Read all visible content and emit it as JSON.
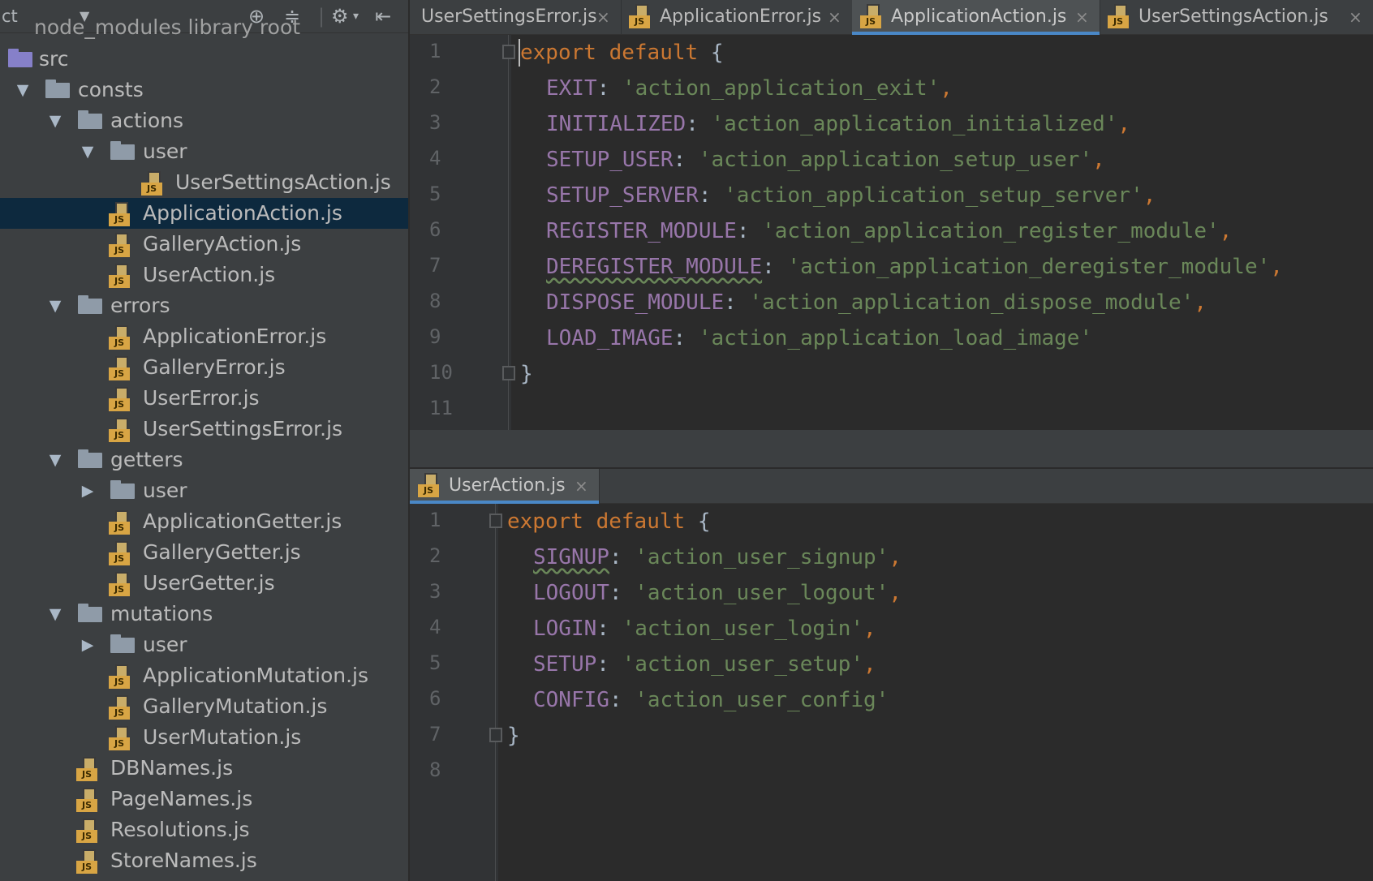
{
  "sidebar": {
    "toolbar": {
      "view_selector": "ct",
      "dropdown_icon": "chevron-down-icon",
      "icons": [
        "locate-icon",
        "collapse-all-icon",
        "gear-icon",
        "hide-panel-icon"
      ]
    },
    "partial_item": "node_modules  library root",
    "tree": [
      {
        "label": "src",
        "type": "src-folder"
      },
      {
        "label": "consts",
        "type": "folder",
        "expanded": true
      },
      {
        "label": "actions",
        "type": "folder",
        "expanded": true
      },
      {
        "label": "user",
        "type": "folder",
        "expanded": true
      },
      {
        "label": "UserSettingsAction.js",
        "type": "js"
      },
      {
        "label": "ApplicationAction.js",
        "type": "js",
        "selected": true
      },
      {
        "label": "GalleryAction.js",
        "type": "js"
      },
      {
        "label": "UserAction.js",
        "type": "js"
      },
      {
        "label": "errors",
        "type": "folder",
        "expanded": true
      },
      {
        "label": "ApplicationError.js",
        "type": "js"
      },
      {
        "label": "GalleryError.js",
        "type": "js"
      },
      {
        "label": "UserError.js",
        "type": "js"
      },
      {
        "label": "UserSettingsError.js",
        "type": "js"
      },
      {
        "label": "getters",
        "type": "folder",
        "expanded": true
      },
      {
        "label": "user",
        "type": "folder",
        "expanded": false
      },
      {
        "label": "ApplicationGetter.js",
        "type": "js"
      },
      {
        "label": "GalleryGetter.js",
        "type": "js"
      },
      {
        "label": "UserGetter.js",
        "type": "js"
      },
      {
        "label": "mutations",
        "type": "folder",
        "expanded": true
      },
      {
        "label": "user",
        "type": "folder",
        "expanded": false
      },
      {
        "label": "ApplicationMutation.js",
        "type": "js"
      },
      {
        "label": "GalleryMutation.js",
        "type": "js"
      },
      {
        "label": "UserMutation.js",
        "type": "js"
      },
      {
        "label": "DBNames.js",
        "type": "js"
      },
      {
        "label": "PageNames.js",
        "type": "js"
      },
      {
        "label": "Resolutions.js",
        "type": "js"
      },
      {
        "label": "StoreNames.js",
        "type": "js"
      }
    ]
  },
  "js_badge": "JS",
  "close_glyph": "×",
  "top_pane": {
    "tabs": [
      {
        "label": "UserSettingsError.js",
        "active": false
      },
      {
        "label": "ApplicationError.js",
        "active": false
      },
      {
        "label": "ApplicationAction.js",
        "active": true
      },
      {
        "label": "UserSettingsAction.js",
        "active": false
      }
    ],
    "line_numbers": [
      "1",
      "2",
      "3",
      "4",
      "5",
      "6",
      "7",
      "8",
      "9",
      "10",
      "11"
    ],
    "code": {
      "open": {
        "kw1": "export",
        "kw2": "default",
        "brace": "{"
      },
      "entries": [
        {
          "key": "EXIT",
          "value": "'action_application_exit'",
          "comma": ","
        },
        {
          "key": "INITIALIZED",
          "value": "'action_application_initialized'",
          "comma": ","
        },
        {
          "key": "SETUP_USER",
          "value": "'action_application_setup_user'",
          "comma": ","
        },
        {
          "key": "SETUP_SERVER",
          "value": "'action_application_setup_server'",
          "comma": ","
        },
        {
          "key": "REGISTER_MODULE",
          "value": "'action_application_register_module'",
          "comma": ","
        },
        {
          "key": "DEREGISTER_MODULE",
          "value": "'action_application_deregister_module'",
          "comma": ","
        },
        {
          "key": "DISPOSE_MODULE",
          "value": "'action_application_dispose_module'",
          "comma": ","
        },
        {
          "key": "LOAD_IMAGE",
          "value": "'action_application_load_image'",
          "comma": ""
        }
      ],
      "close": "}"
    }
  },
  "bottom_pane": {
    "tabs": [
      {
        "label": "UserAction.js",
        "active": true
      }
    ],
    "line_numbers": [
      "1",
      "2",
      "3",
      "4",
      "5",
      "6",
      "7",
      "8"
    ],
    "code": {
      "open": {
        "kw1": "export",
        "kw2": "default",
        "brace": "{"
      },
      "entries": [
        {
          "key": "SIGNUP",
          "value": "'action_user_signup'",
          "comma": ","
        },
        {
          "key": "LOGOUT",
          "value": "'action_user_logout'",
          "comma": ","
        },
        {
          "key": "LOGIN",
          "value": "'action_user_login'",
          "comma": ","
        },
        {
          "key": "SETUP",
          "value": "'action_user_setup'",
          "comma": ","
        },
        {
          "key": "CONFIG",
          "value": "'action_user_config'",
          "comma": ""
        }
      ],
      "close": "}"
    }
  },
  "colors": {
    "keyword": "#cc7832",
    "property": "#9876aa",
    "string": "#6a8759",
    "selection": "#0d293e",
    "tab_underline": "#4a88c7"
  }
}
